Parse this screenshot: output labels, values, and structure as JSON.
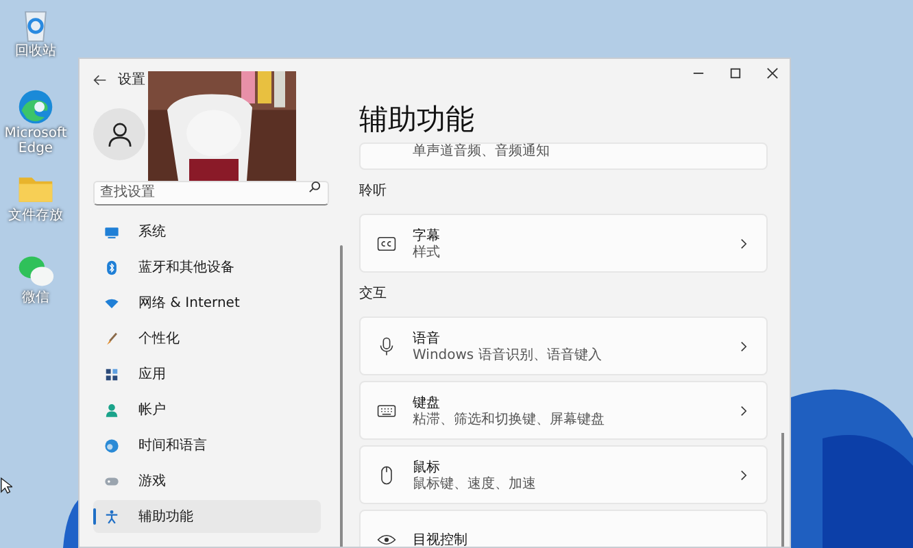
{
  "desktop_icons": [
    {
      "label": "回收站",
      "kind": "recycle"
    },
    {
      "label": "Microsoft Edge",
      "kind": "edge"
    },
    {
      "label": "文件存放",
      "kind": "folder"
    },
    {
      "label": "微信",
      "kind": "chat"
    }
  ],
  "window": {
    "title": "设置"
  },
  "search": {
    "placeholder": "查找设置"
  },
  "sidebar": {
    "items": [
      {
        "label": "系统",
        "kind": "system",
        "selected": false
      },
      {
        "label": "蓝牙和其他设备",
        "kind": "bluetooth",
        "selected": false
      },
      {
        "label": "网络 & Internet",
        "kind": "wifi",
        "selected": false
      },
      {
        "label": "个性化",
        "kind": "brush",
        "selected": false
      },
      {
        "label": "应用",
        "kind": "apps",
        "selected": false
      },
      {
        "label": "帐户",
        "kind": "account",
        "selected": false
      },
      {
        "label": "时间和语言",
        "kind": "globe",
        "selected": false
      },
      {
        "label": "游戏",
        "kind": "game",
        "selected": false
      },
      {
        "label": "辅助功能",
        "kind": "access",
        "selected": true
      }
    ]
  },
  "page": {
    "heading": "辅助功能",
    "top_card": {
      "subtitle": "单声道音频、音频通知"
    },
    "sections": [
      {
        "title": "聆听",
        "cards": [
          {
            "title": "字幕",
            "subtitle": "样式",
            "kind": "cc"
          }
        ]
      },
      {
        "title": "交互",
        "cards": [
          {
            "title": "语音",
            "subtitle": "Windows 语音识别、语音键入",
            "kind": "mic"
          },
          {
            "title": "键盘",
            "subtitle": "粘滞、筛选和切换键、屏幕键盘",
            "kind": "keyboard"
          },
          {
            "title": "鼠标",
            "subtitle": "鼠标键、速度、加速",
            "kind": "mouse"
          },
          {
            "title": "目视控制",
            "kind": "eye"
          }
        ]
      }
    ]
  }
}
